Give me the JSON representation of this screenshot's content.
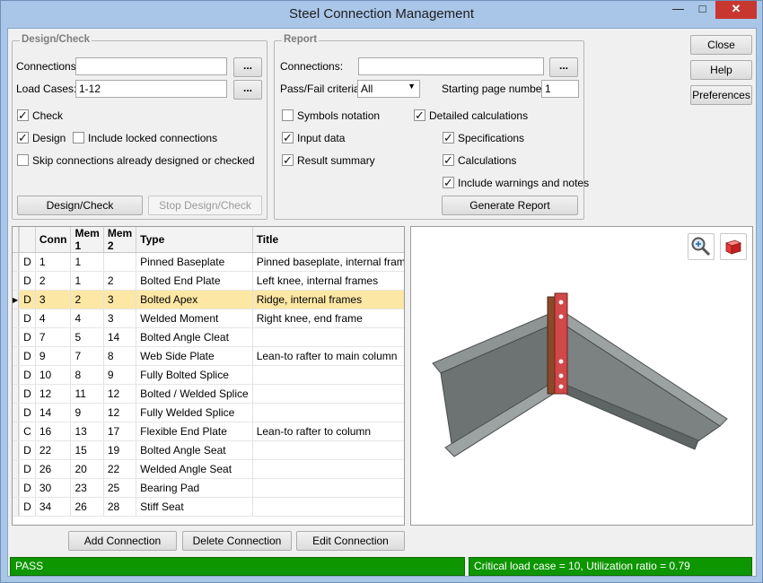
{
  "window": {
    "title": "Steel Connection Management"
  },
  "titlebar_buttons": {
    "minimize": "—",
    "maximize": "□",
    "close": "✕"
  },
  "design_check": {
    "title": "Design/Check",
    "connections_label": "Connections:",
    "connections_value": "",
    "connections_browse": "...",
    "load_cases_label": "Load Cases:",
    "load_cases_value": "1-12",
    "load_cases_browse": "...",
    "check_label": "Check",
    "check_checked": true,
    "design_label": "Design",
    "design_checked": true,
    "include_locked_label": "Include locked connections",
    "include_locked_checked": false,
    "skip_label": "Skip connections already designed or checked",
    "skip_checked": false,
    "design_check_button": "Design/Check",
    "stop_button": "Stop Design/Check"
  },
  "report": {
    "title": "Report",
    "connections_label": "Connections:",
    "connections_value": "",
    "connections_browse": "...",
    "passfail_label": "Pass/Fail criteria:",
    "passfail_value": "All",
    "start_page_label": "Starting page number:",
    "start_page_value": "1",
    "symbols_label": "Symbols notation",
    "detailed_label": "Detailed calculations",
    "input_label": "Input data",
    "specs_label": "Specifications",
    "result_label": "Result summary",
    "calcs_label": "Calculations",
    "warnings_label": "Include warnings and notes",
    "generate_button": "Generate Report",
    "checkmark": "✓"
  },
  "side_buttons": {
    "close": "Close",
    "help": "Help",
    "preferences": "Preferences"
  },
  "grid": {
    "columns": [
      "Conn",
      "Mem 1",
      "Mem 2",
      "Type",
      "Title"
    ],
    "rows": [
      {
        "status_color": "#0a8a0a",
        "flag": "D",
        "conn": "1",
        "mem1": "1",
        "mem2": "",
        "type": "Pinned Baseplate",
        "title": "Pinned baseplate, internal frames"
      },
      {
        "status_color": "#0a8a0a",
        "flag": "D",
        "conn": "2",
        "mem1": "1",
        "mem2": "2",
        "type": "Bolted End Plate",
        "title": "Left knee, internal frames"
      },
      {
        "status_color": "#0a8a0a",
        "flag": "D",
        "conn": "3",
        "mem1": "2",
        "mem2": "3",
        "type": "Bolted Apex",
        "title": "Ridge, internal frames",
        "selected": true
      },
      {
        "status_color": "#0a8a0a",
        "flag": "D",
        "conn": "4",
        "mem1": "4",
        "mem2": "3",
        "type": "Welded Moment",
        "title": "Right knee, end frame"
      },
      {
        "status_color": "#0a8a0a",
        "flag": "D",
        "conn": "7",
        "mem1": "5",
        "mem2": "14",
        "type": "Bolted Angle Cleat",
        "title": ""
      },
      {
        "status_color": "#0a8a0a",
        "flag": "D",
        "conn": "9",
        "mem1": "7",
        "mem2": "8",
        "type": "Web Side Plate",
        "title": "Lean-to rafter to main column"
      },
      {
        "status_color": "#8b0000",
        "flag": "D",
        "conn": "10",
        "mem1": "8",
        "mem2": "9",
        "type": "Fully Bolted Splice",
        "title": ""
      },
      {
        "status_color": "#8b0000",
        "flag": "D",
        "conn": "12",
        "mem1": "11",
        "mem2": "12",
        "type": "Bolted / Welded Splice",
        "title": ""
      },
      {
        "status_color": "#0a8a0a",
        "flag": "D",
        "conn": "14",
        "mem1": "9",
        "mem2": "12",
        "type": "Fully Welded Splice",
        "title": ""
      },
      {
        "status_color": "#c8c800",
        "flag": "C",
        "conn": "16",
        "mem1": "13",
        "mem2": "17",
        "type": "Flexible End Plate",
        "title": "Lean-to rafter to column"
      },
      {
        "status_color": "#0a8a0a",
        "flag": "D",
        "conn": "22",
        "mem1": "15",
        "mem2": "19",
        "type": "Bolted Angle Seat",
        "title": ""
      },
      {
        "status_color": "#0a8a0a",
        "flag": "D",
        "conn": "26",
        "mem1": "20",
        "mem2": "22",
        "type": "Welded Angle Seat",
        "title": ""
      },
      {
        "status_color": "#0a8a0a",
        "flag": "D",
        "conn": "30",
        "mem1": "23",
        "mem2": "25",
        "type": "Bearing Pad",
        "title": ""
      },
      {
        "status_color": "#0a8a0a",
        "flag": "D",
        "conn": "34",
        "mem1": "26",
        "mem2": "28",
        "type": "Stiff Seat",
        "title": ""
      }
    ],
    "selected_indicator": "▶"
  },
  "viewer": {
    "zoom_icon": "magnifier-zoom-icon",
    "view3d_icon": "3d-cube-icon"
  },
  "bottom_buttons": {
    "add": "Add Connection",
    "delete": "Delete Connection",
    "edit": "Edit Connection"
  },
  "status": {
    "left": "PASS",
    "right": "Critical load case = 10, Utilization ratio = 0.79",
    "pass_color": "#0d9600"
  }
}
